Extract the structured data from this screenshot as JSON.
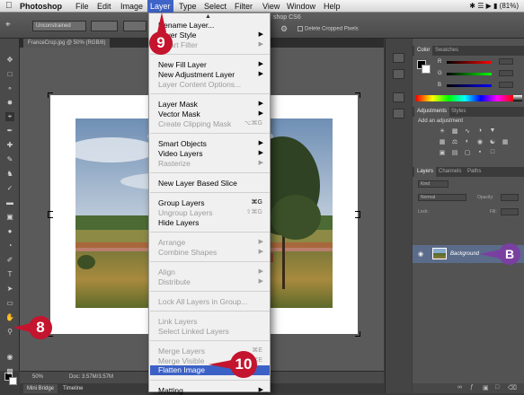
{
  "menubar": {
    "app_name": "Photoshop",
    "items": [
      "File",
      "Edit",
      "Image",
      "Layer",
      "Type",
      "Select",
      "Filter",
      "View",
      "Window",
      "Help"
    ],
    "battery": "(81%)"
  },
  "options": {
    "style_value": "Unconstrained",
    "window_title": "shop CS6",
    "delete_cropped": "Delete Cropped Pixels"
  },
  "document": {
    "tab_title": "FranceCrop.jpg @ 50% (RGB/8)",
    "zoom": "50%",
    "doc_size": "Doc: 3.57M/3.57M"
  },
  "bottom_tabs": [
    "Mini Bridge",
    "Timeline"
  ],
  "panels": {
    "color_tabs": [
      "Color",
      "Swatches"
    ],
    "color_channels": [
      "R",
      "G",
      "B"
    ],
    "adjust_tabs": [
      "Adjustments",
      "Styles"
    ],
    "adjust_label": "Add an adjustment",
    "layer_tabs": [
      "Layers",
      "Channels",
      "Paths"
    ],
    "filter_kind": "Kind",
    "blend_mode": "Normal",
    "opacity_label": "Opacity:",
    "lock_label": "Lock:",
    "fill_label": "Fill:",
    "layer_name": "Background"
  },
  "layer_menu": {
    "groups": [
      [
        {
          "label": "Rename Layer...",
          "enabled": true,
          "shortcut": "",
          "submenu": false
        },
        {
          "label": "Layer Style",
          "enabled": true,
          "shortcut": "",
          "submenu": true
        },
        {
          "label": "Smart Filter",
          "enabled": false,
          "shortcut": "",
          "submenu": true
        }
      ],
      [
        {
          "label": "New Fill Layer",
          "enabled": true,
          "shortcut": "",
          "submenu": true
        },
        {
          "label": "New Adjustment Layer",
          "enabled": true,
          "shortcut": "",
          "submenu": true
        },
        {
          "label": "Layer Content Options...",
          "enabled": false,
          "shortcut": "",
          "submenu": false
        }
      ],
      [
        {
          "label": "Layer Mask",
          "enabled": true,
          "shortcut": "",
          "submenu": true
        },
        {
          "label": "Vector Mask",
          "enabled": true,
          "shortcut": "",
          "submenu": true
        },
        {
          "label": "Create Clipping Mask",
          "enabled": false,
          "shortcut": "⌥⌘G",
          "submenu": false
        }
      ],
      [
        {
          "label": "Smart Objects",
          "enabled": true,
          "shortcut": "",
          "submenu": true
        },
        {
          "label": "Video Layers",
          "enabled": true,
          "shortcut": "",
          "submenu": true
        },
        {
          "label": "Rasterize",
          "enabled": false,
          "shortcut": "",
          "submenu": true
        }
      ],
      [
        {
          "label": "New Layer Based Slice",
          "enabled": true,
          "shortcut": "",
          "submenu": false
        }
      ],
      [
        {
          "label": "Group Layers",
          "enabled": true,
          "shortcut": "⌘G",
          "submenu": false
        },
        {
          "label": "Ungroup Layers",
          "enabled": false,
          "shortcut": "⇧⌘G",
          "submenu": false
        },
        {
          "label": "Hide Layers",
          "enabled": true,
          "shortcut": "",
          "submenu": false
        }
      ],
      [
        {
          "label": "Arrange",
          "enabled": false,
          "shortcut": "",
          "submenu": true
        },
        {
          "label": "Combine Shapes",
          "enabled": false,
          "shortcut": "",
          "submenu": true
        }
      ],
      [
        {
          "label": "Align",
          "enabled": false,
          "shortcut": "",
          "submenu": true
        },
        {
          "label": "Distribute",
          "enabled": false,
          "shortcut": "",
          "submenu": true
        }
      ],
      [
        {
          "label": "Lock All Layers in Group...",
          "enabled": false,
          "shortcut": "",
          "submenu": false
        }
      ],
      [
        {
          "label": "Link Layers",
          "enabled": false,
          "shortcut": "",
          "submenu": false
        },
        {
          "label": "Select Linked Layers",
          "enabled": false,
          "shortcut": "",
          "submenu": false
        }
      ],
      [
        {
          "label": "Merge Layers",
          "enabled": false,
          "shortcut": "⌘E",
          "submenu": false
        },
        {
          "label": "Merge Visible",
          "enabled": false,
          "shortcut": "⇧⌘E",
          "submenu": false
        },
        {
          "label": "Flatten Image",
          "enabled": true,
          "shortcut": "",
          "submenu": false,
          "highlighted": true
        }
      ],
      [
        {
          "label": "Matting",
          "enabled": true,
          "shortcut": "",
          "submenu": true
        }
      ]
    ]
  },
  "callouts": {
    "step_menu": "9",
    "step_tool": "8",
    "step_flatten": "10",
    "step_layer": "B",
    "colors": {
      "step": "#c4142e",
      "bullet": "#7a3fa0"
    }
  }
}
